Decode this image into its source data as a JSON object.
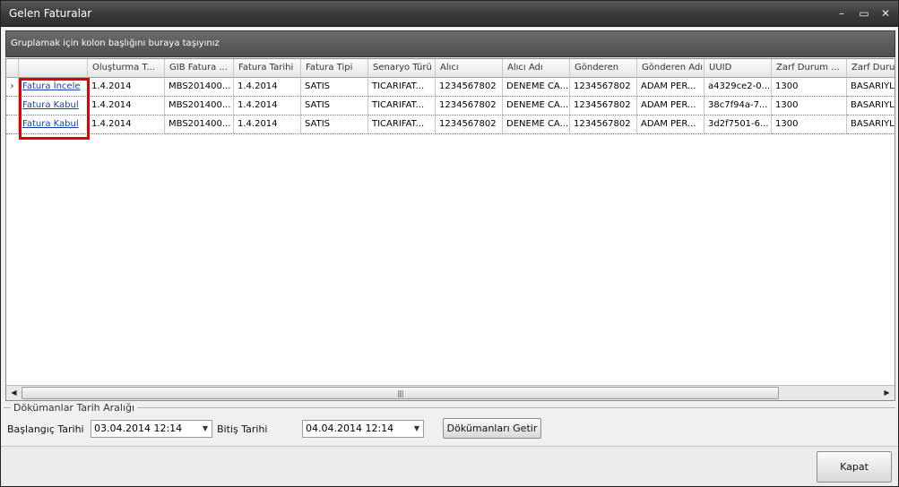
{
  "window": {
    "title": "Gelen Faturalar",
    "minimize_icon": "minimize-icon",
    "maximize_icon": "maximize-icon",
    "close_icon": "close-icon"
  },
  "groupbar": {
    "hint": "Gruplamak için kolon başlığını buraya taşıyınız"
  },
  "grid": {
    "columns": [
      "Oluşturma T...",
      "GIB Fatura ...",
      "Fatura Tarihi",
      "Fatura Tipi",
      "Senaryo Türü",
      "Alıcı",
      "Alıcı Adı",
      "Gönderen",
      "Gönderen Adı",
      "UUID",
      "Zarf Durum ...",
      "Zarf Durum"
    ],
    "rows": [
      {
        "indicator": "›",
        "action": "Fatura İncele",
        "cells": [
          "1.4.2014",
          "MBS201400...",
          "1.4.2014",
          "SATIS",
          "TICARIFAT...",
          "1234567802",
          "DENEME CA...",
          "1234567802",
          "ADAM PER...",
          "a4329ce2-0...",
          "1300",
          "BASARIYLA"
        ]
      },
      {
        "indicator": "",
        "action": "Fatura Kabul",
        "cells": [
          "1.4.2014",
          "MBS201400...",
          "1.4.2014",
          "SATIS",
          "TICARIFAT...",
          "1234567802",
          "DENEME CA...",
          "1234567802",
          "ADAM PER...",
          "38c7f94a-7...",
          "1300",
          "BASARIYLA"
        ]
      },
      {
        "indicator": "",
        "action": "Fatura Kabul",
        "cells": [
          "1.4.2014",
          "MBS201400...",
          "1.4.2014",
          "SATIS",
          "TICARIFAT...",
          "1234567802",
          "DENEME CA...",
          "1234567802",
          "ADAM PER...",
          "3d2f7501-6...",
          "1300",
          "BASARIYLA"
        ]
      }
    ],
    "scrollbar": {
      "left_icon": "◀",
      "right_icon": "▶",
      "grip": "||||"
    }
  },
  "daterange": {
    "legend": "Dökümanlar Tarih Aralığı",
    "start_label": "Başlangıç Tarihi",
    "start_value": "03.04.2014 12:14",
    "end_label": "Bitiş Tarihi",
    "end_value": "04.04.2014 12:14",
    "fetch_button": "Dökümanları Getir",
    "dropdown_icon": "▼"
  },
  "footer": {
    "close_button": "Kapat"
  }
}
